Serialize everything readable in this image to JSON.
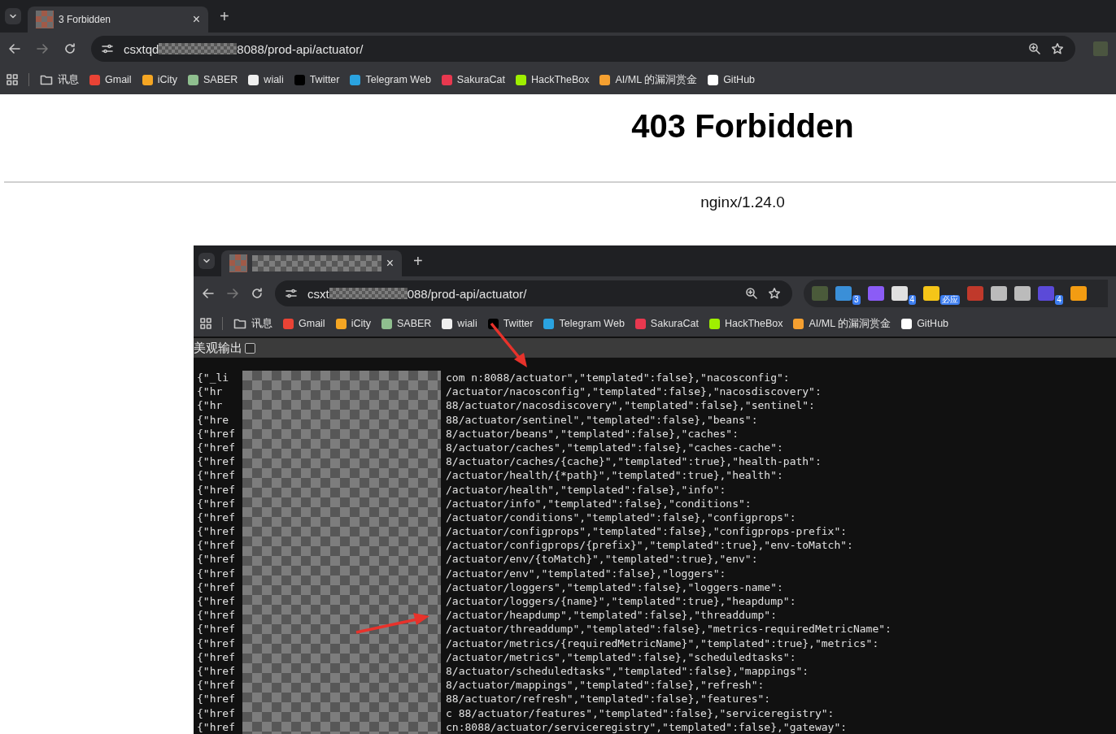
{
  "outer_browser": {
    "tab": {
      "title": "3 Forbidden",
      "close": "×"
    },
    "new_tab": "+",
    "address": {
      "before": "csxtqd",
      "after": "8088/prod-api/actuator/"
    },
    "bookmarks": [
      {
        "kind": "folder",
        "label": "讯息",
        "color": "#c8c8c8"
      },
      {
        "kind": "site",
        "label": "Gmail",
        "color": "#ea4335"
      },
      {
        "kind": "site",
        "label": "iCity",
        "color": "#f5a623"
      },
      {
        "kind": "site",
        "label": "SABER",
        "color": "#8fbf8f"
      },
      {
        "kind": "site",
        "label": "wiali",
        "color": "#f0f0f0"
      },
      {
        "kind": "site",
        "label": "Twitter",
        "color": "#000000"
      },
      {
        "kind": "site",
        "label": "Telegram Web",
        "color": "#2aa3e0"
      },
      {
        "kind": "site",
        "label": "SakuraCat",
        "color": "#e8384f"
      },
      {
        "kind": "site",
        "label": "HackTheBox",
        "color": "#9fef00"
      },
      {
        "kind": "site",
        "label": "AI/ML 的漏洞赏金",
        "color": "#f5a030"
      },
      {
        "kind": "site",
        "label": "GitHub",
        "color": "#ffffff"
      }
    ]
  },
  "page": {
    "heading": "403 Forbidden",
    "server": "nginx/1.24.0"
  },
  "inner_browser": {
    "tab": {
      "close": "×"
    },
    "new_tab": "+",
    "address": {
      "before": "csxt",
      "after": "088/prod-api/actuator/"
    },
    "extensions": [
      {
        "color": "#4a5a3a"
      },
      {
        "color": "#3a8fd8",
        "badge": "3"
      },
      {
        "color": "#8b5cf6"
      },
      {
        "color": "#e0e0e0",
        "badge": "4"
      },
      {
        "color": "#f5c518",
        "badge": "必应"
      },
      {
        "color": "#c0392b"
      },
      {
        "color": "#bbbbbb"
      },
      {
        "color": "#bbbbbb"
      },
      {
        "color": "#5b4ad8",
        "badge": "4"
      },
      {
        "color": "#f39c12"
      }
    ],
    "bookmarks": [
      {
        "kind": "folder",
        "label": "讯息",
        "color": "#c8c8c8"
      },
      {
        "kind": "site",
        "label": "Gmail",
        "color": "#ea4335"
      },
      {
        "kind": "site",
        "label": "iCity",
        "color": "#f5a623"
      },
      {
        "kind": "site",
        "label": "SABER",
        "color": "#8fbf8f"
      },
      {
        "kind": "site",
        "label": "wiali",
        "color": "#f0f0f0"
      },
      {
        "kind": "site",
        "label": "Twitter",
        "color": "#000000"
      },
      {
        "kind": "site",
        "label": "Telegram Web",
        "color": "#2aa3e0"
      },
      {
        "kind": "site",
        "label": "SakuraCat",
        "color": "#e8384f"
      },
      {
        "kind": "site",
        "label": "HackTheBox",
        "color": "#9fef00"
      },
      {
        "kind": "site",
        "label": "AI/ML 的漏洞赏金",
        "color": "#f5a030"
      },
      {
        "kind": "site",
        "label": "GitHub",
        "color": "#ffffff"
      }
    ],
    "pretty_print": {
      "label": "美观输出",
      "checked": false
    },
    "json_lines": [
      {
        "head": "{\"_li",
        "tail": "com  n:8088/actuator\",\"templated\":false},\"nacosconfig\":"
      },
      {
        "head": "{\"hr",
        "tail": "/actuator/nacosconfig\",\"templated\":false},\"nacosdiscovery\":"
      },
      {
        "head": "{\"hr",
        "tail": "88/actuator/nacosdiscovery\",\"templated\":false},\"sentinel\":"
      },
      {
        "head": "{\"hre",
        "tail": "88/actuator/sentinel\",\"templated\":false},\"beans\":"
      },
      {
        "head": "{\"href",
        "tail": "8/actuator/beans\",\"templated\":false},\"caches\":"
      },
      {
        "head": "{\"href",
        "tail": "8/actuator/caches\",\"templated\":false},\"caches-cache\":"
      },
      {
        "head": "{\"href",
        "tail": "8/actuator/caches/{cache}\",\"templated\":true},\"health-path\":"
      },
      {
        "head": "{\"href",
        "tail": "/actuator/health/{*path}\",\"templated\":true},\"health\":"
      },
      {
        "head": "{\"href",
        "tail": "/actuator/health\",\"templated\":false},\"info\":"
      },
      {
        "head": "{\"href",
        "tail": "/actuator/info\",\"templated\":false},\"conditions\":"
      },
      {
        "head": "{\"href",
        "tail": "/actuator/conditions\",\"templated\":false},\"configprops\":"
      },
      {
        "head": "{\"href",
        "tail": "/actuator/configprops\",\"templated\":false},\"configprops-prefix\":"
      },
      {
        "head": "{\"href",
        "tail": "/actuator/configprops/{prefix}\",\"templated\":true},\"env-toMatch\":"
      },
      {
        "head": "{\"href",
        "tail": "/actuator/env/{toMatch}\",\"templated\":true},\"env\":"
      },
      {
        "head": "{\"href",
        "tail": "/actuator/env\",\"templated\":false},\"loggers\":"
      },
      {
        "head": "{\"href",
        "tail": "/actuator/loggers\",\"templated\":false},\"loggers-name\":"
      },
      {
        "head": "{\"href",
        "tail": "/actuator/loggers/{name}\",\"templated\":true},\"heapdump\":"
      },
      {
        "head": "{\"href",
        "tail": "/actuator/heapdump\",\"templated\":false},\"threaddump\":"
      },
      {
        "head": "{\"href",
        "tail": "/actuator/threaddump\",\"templated\":false},\"metrics-requiredMetricName\":"
      },
      {
        "head": "{\"href",
        "tail": "/actuator/metrics/{requiredMetricName}\",\"templated\":true},\"metrics\":"
      },
      {
        "head": "{\"href",
        "tail": "/actuator/metrics\",\"templated\":false},\"scheduledtasks\":"
      },
      {
        "head": "{\"href",
        "tail": "8/actuator/scheduledtasks\",\"templated\":false},\"mappings\":"
      },
      {
        "head": "{\"href",
        "tail": "8/actuator/mappings\",\"templated\":false},\"refresh\":"
      },
      {
        "head": "{\"href",
        "tail": "88/actuator/refresh\",\"templated\":false},\"features\":"
      },
      {
        "head": "{\"href",
        "tail": "c  88/actuator/features\",\"templated\":false},\"serviceregistry\":"
      },
      {
        "head": "{\"href",
        "tail": "cn:8088/actuator/serviceregistry\",\"templated\":false},\"gateway\":"
      }
    ]
  }
}
